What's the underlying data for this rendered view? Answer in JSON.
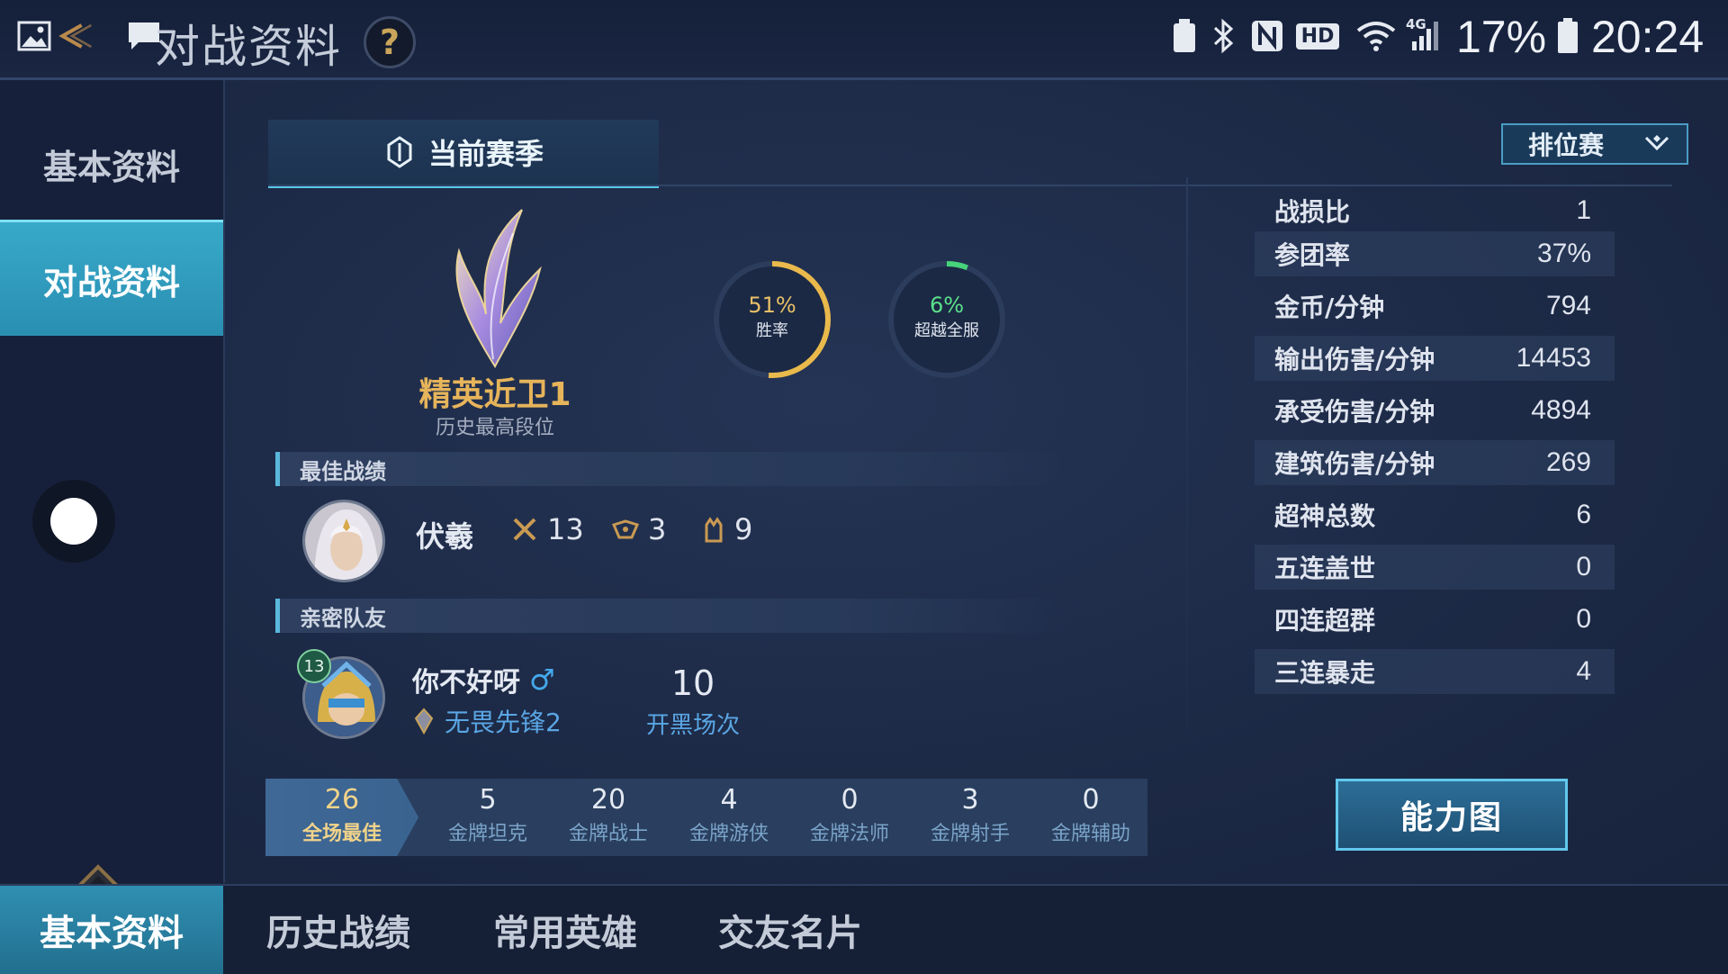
{
  "status_bar": {
    "title": "对战资料",
    "help_label": "?",
    "battery_percent": "17%",
    "time": "20:24",
    "network_badge": "HD",
    "signal_label": "4G"
  },
  "sidebar": {
    "items": [
      {
        "label": "基本资料",
        "active": false
      },
      {
        "label": "对战资料",
        "active": true
      }
    ]
  },
  "header": {
    "season_tab": "当前赛季",
    "mode_select": "排位赛"
  },
  "rank": {
    "name": "精英近卫1",
    "subtitle": "历史最高段位"
  },
  "rings": {
    "win_rate": {
      "value": "51%",
      "caption": "胜率",
      "fraction": 0.51,
      "color": "#e9b94c"
    },
    "surpass": {
      "value": "6%",
      "caption": "超越全服",
      "fraction": 0.06,
      "color": "#46d37a"
    }
  },
  "best_record": {
    "heading": "最佳战绩",
    "hero": "伏羲",
    "kills": "13",
    "deaths": "3",
    "assists": "9"
  },
  "close_friend": {
    "heading": "亲密队友",
    "level": "13",
    "name": "你不好呀",
    "gender_symbol": "♂",
    "rank": "无畏先锋2",
    "games_value": "10",
    "games_label": "开黑场次"
  },
  "medals": [
    {
      "value": "26",
      "label": "全场最佳"
    },
    {
      "value": "5",
      "label": "金牌坦克"
    },
    {
      "value": "20",
      "label": "金牌战士"
    },
    {
      "value": "4",
      "label": "金牌游侠"
    },
    {
      "value": "0",
      "label": "金牌法师"
    },
    {
      "value": "3",
      "label": "金牌射手"
    },
    {
      "value": "0",
      "label": "金牌辅助"
    }
  ],
  "stats": [
    {
      "label": "战损比",
      "value": "1"
    },
    {
      "label": "参团率",
      "value": "37%"
    },
    {
      "label": "金币/分钟",
      "value": "794"
    },
    {
      "label": "输出伤害/分钟",
      "value": "14453"
    },
    {
      "label": "承受伤害/分钟",
      "value": "4894"
    },
    {
      "label": "建筑伤害/分钟",
      "value": "269"
    },
    {
      "label": "超神总数",
      "value": "6"
    },
    {
      "label": "五连盖世",
      "value": "0"
    },
    {
      "label": "四连超群",
      "value": "0"
    },
    {
      "label": "三连暴走",
      "value": "4"
    }
  ],
  "ability_button": "能力图",
  "bottom_tabs": [
    {
      "label": "基本资料",
      "active": true
    },
    {
      "label": "历史战绩",
      "active": false
    },
    {
      "label": "常用英雄",
      "active": false
    },
    {
      "label": "交友名片",
      "active": false
    }
  ]
}
